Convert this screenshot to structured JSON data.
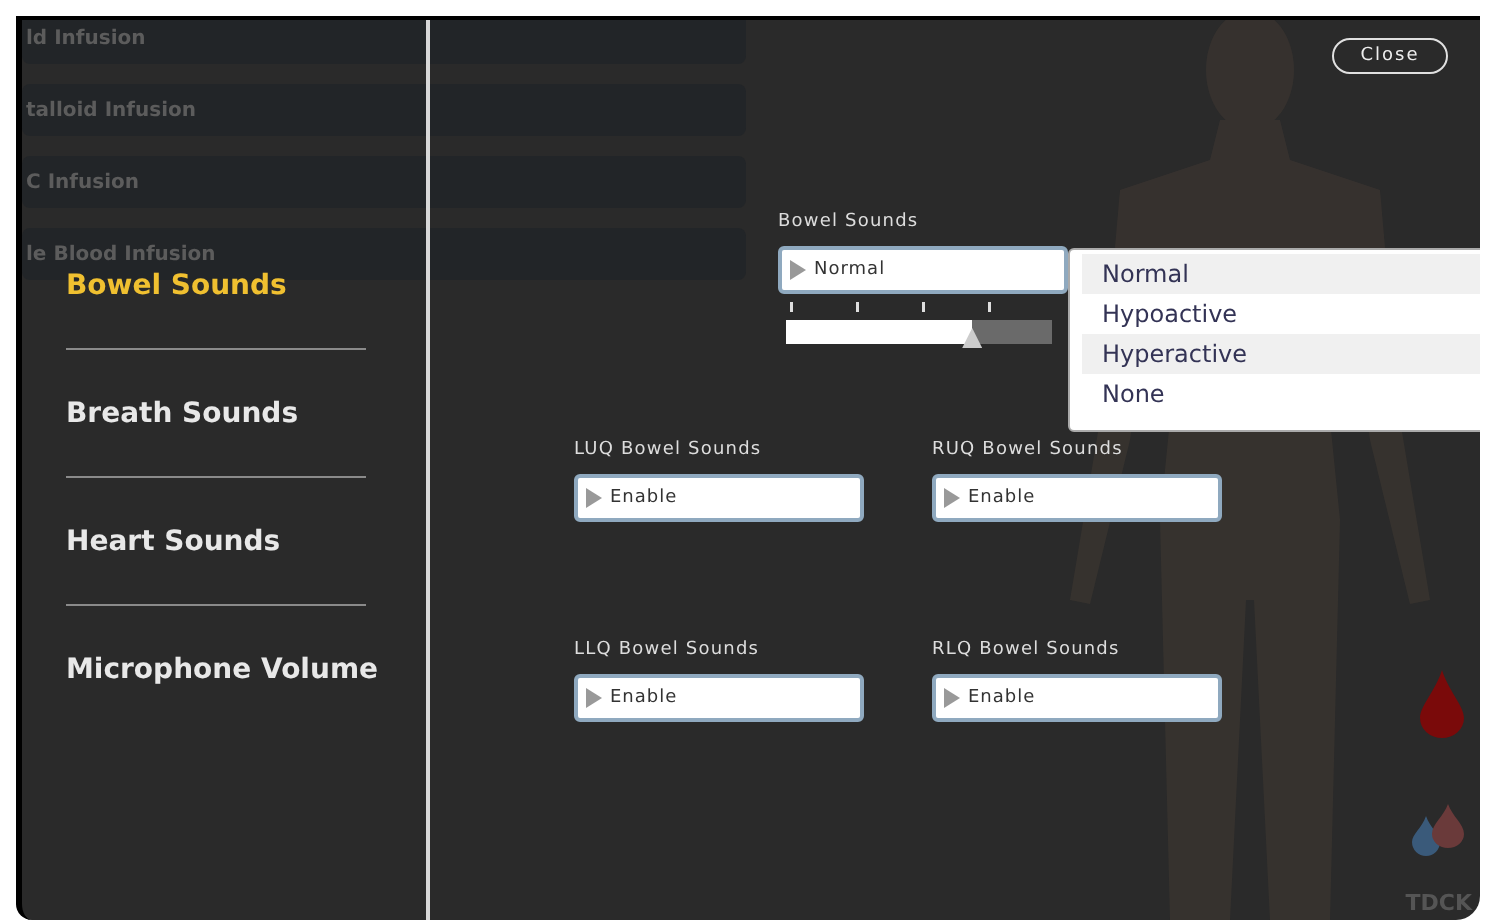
{
  "background_rows": [
    "ld Infusion",
    "talloid Infusion",
    "C Infusion",
    "le Blood Infusion"
  ],
  "sidebar": {
    "items": [
      {
        "label": "Bowel Sounds",
        "selected": true
      },
      {
        "label": "Breath Sounds",
        "selected": false
      },
      {
        "label": "Heart Sounds",
        "selected": false
      },
      {
        "label": "Microphone Volume",
        "selected": false
      }
    ]
  },
  "close_button": "Close",
  "bowel_sounds": {
    "label": "Bowel Sounds",
    "value": "Normal",
    "level": 0.7,
    "expanded": true,
    "options": [
      "Normal",
      "Hypoactive",
      "Hyperactive",
      "None"
    ]
  },
  "quadrants": [
    {
      "label": "LUQ Bowel Sounds",
      "value": "Enable"
    },
    {
      "label": "RUQ Bowel Sounds",
      "value": "Enable"
    },
    {
      "label": "LLQ Bowel Sounds",
      "value": "Enable"
    },
    {
      "label": "RLQ Bowel Sounds",
      "value": "Enable"
    }
  ],
  "logo_text": "TDCK"
}
